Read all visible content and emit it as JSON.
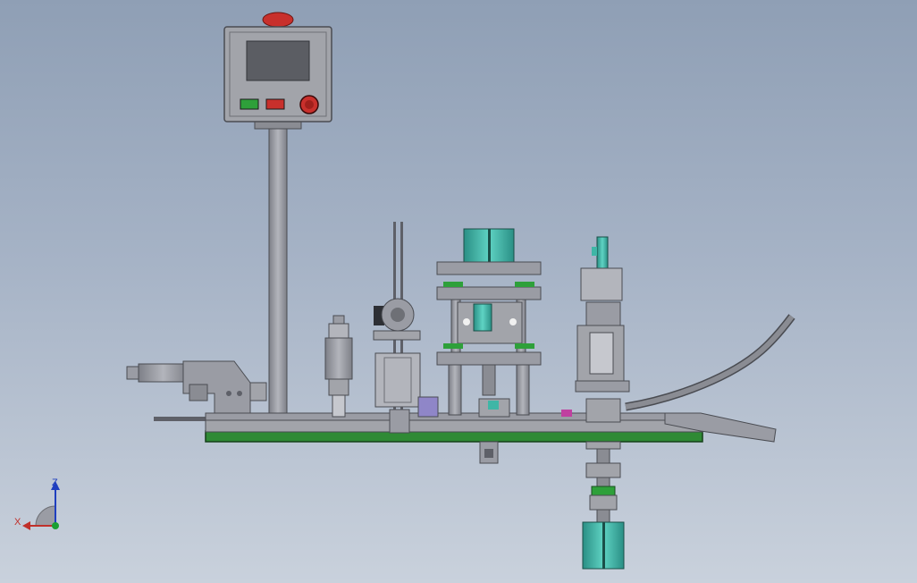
{
  "triad": {
    "x_label": "X",
    "z_label": "Z",
    "x_color": "#c0302a",
    "z_color": "#1f3fbf",
    "y_color": "#1aa033"
  },
  "colors": {
    "base_plate": "#2f8a35",
    "metal": "#9a9ca4",
    "metal_dark": "#5e6068",
    "cylinder": "#3fb6a6",
    "indicator_red": "#c8302c",
    "indicator_green": "#2ea03a"
  }
}
